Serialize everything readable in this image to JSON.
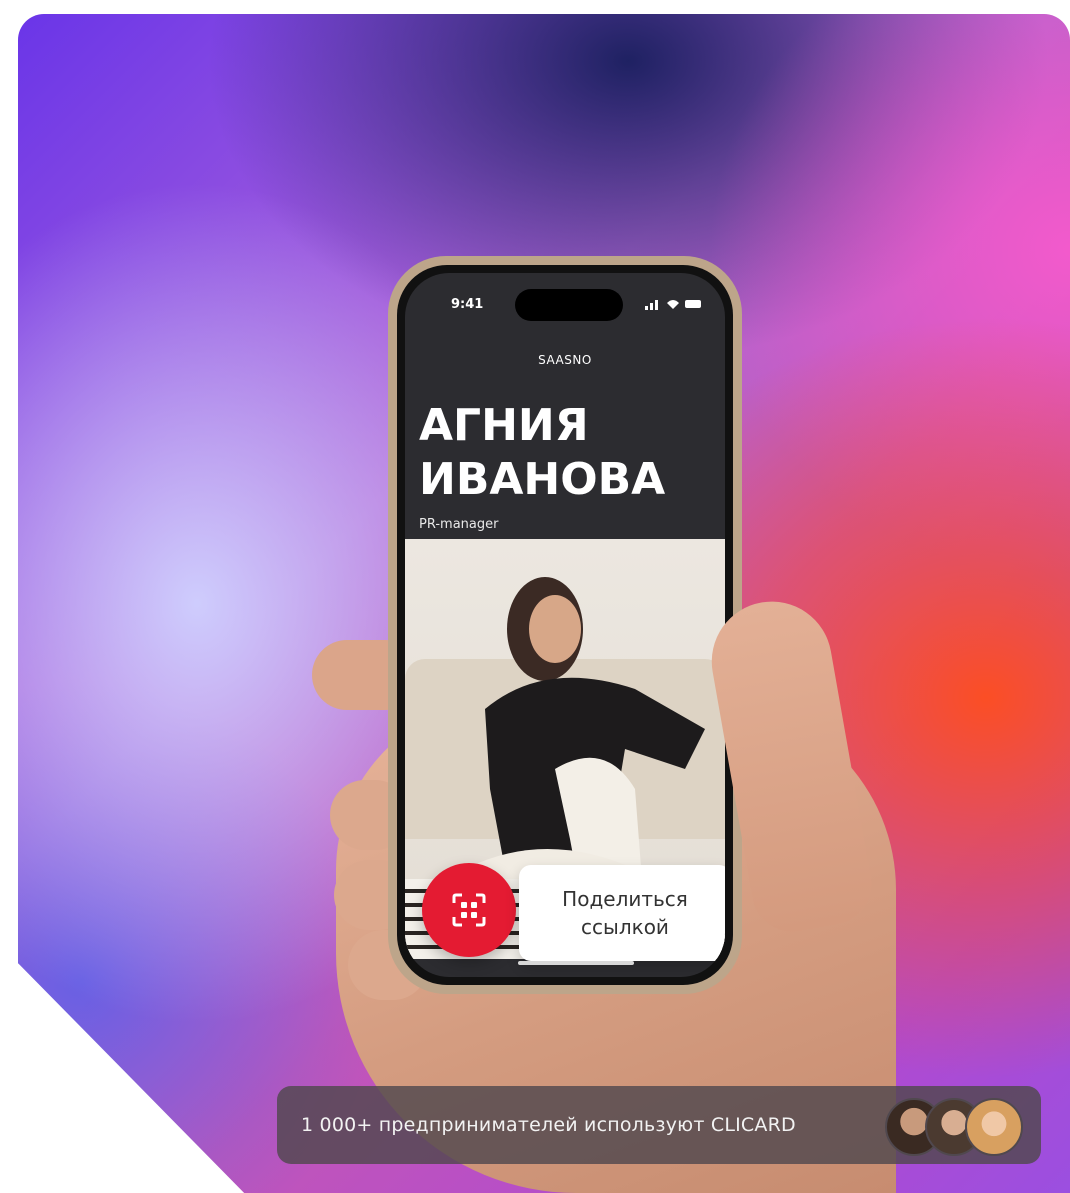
{
  "phone": {
    "status_time": "9:41",
    "brand": "SAASNO",
    "name": "АГНИЯ ИВАНОВА",
    "role": "PR-manager",
    "share_label": "Поделиться ссылкой",
    "qr_icon": "qr-scan-icon",
    "accent_color": "#e41b32"
  },
  "footer": {
    "users_text": "1 000+ предпринимателей используют CLICARD",
    "avatars": [
      "avatar-1",
      "avatar-2",
      "avatar-3"
    ]
  }
}
